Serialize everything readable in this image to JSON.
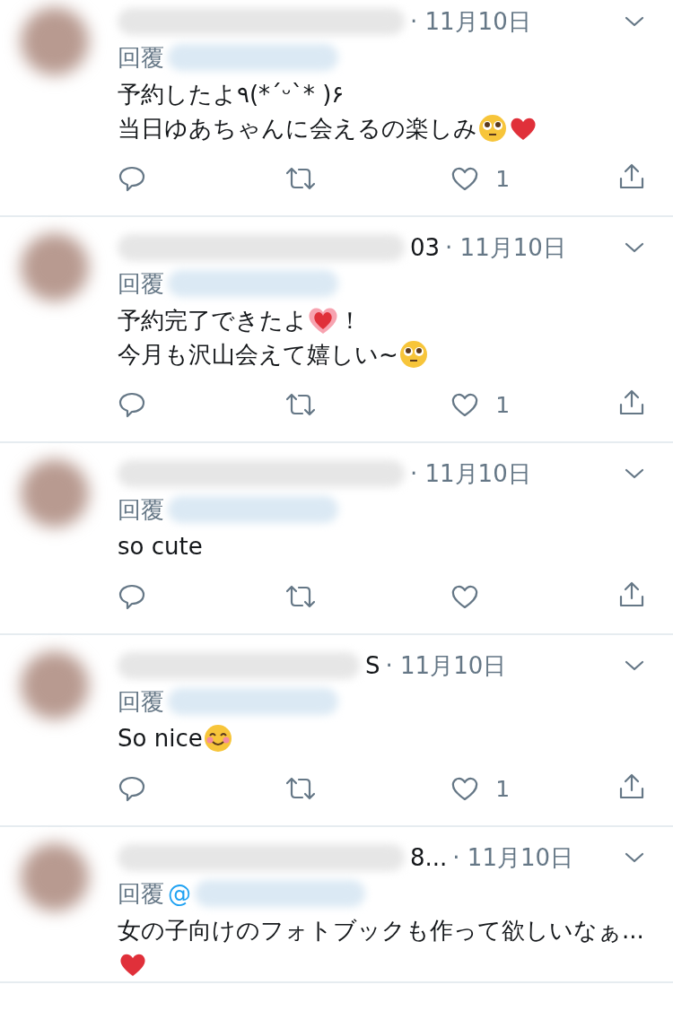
{
  "tweets": [
    {
      "date": "· 11月10日",
      "reply_label": "回覆",
      "body": [
        [
          {
            "kind": "text",
            "text": "予約したよ٩(*´ᵕ`* )۶"
          }
        ],
        [
          {
            "kind": "text",
            "text": "当日ゆあちゃんに会えるの楽しみ"
          },
          {
            "kind": "pleading"
          },
          {
            "kind": "heart"
          }
        ]
      ],
      "likes": "1"
    },
    {
      "name_tail": "03",
      "date": "· 11月10日",
      "reply_label": "回覆",
      "body": [
        [
          {
            "kind": "text",
            "text": "予約完了できたよ"
          },
          {
            "kind": "glowing-heart"
          },
          {
            "kind": "text",
            "text": "！"
          }
        ],
        [
          {
            "kind": "text",
            "text": "今月も沢山会えて嬉しい~"
          },
          {
            "kind": "pleading"
          }
        ]
      ],
      "likes": "1"
    },
    {
      "date": "· 11月10日",
      "reply_label": "回覆",
      "body": [
        [
          {
            "kind": "text",
            "text": "so cute"
          }
        ]
      ]
    },
    {
      "name_tail": "S",
      "date": "· 11月10日",
      "reply_label": "回覆",
      "body": [
        [
          {
            "kind": "text",
            "text": "So nice "
          },
          {
            "kind": "smiling"
          }
        ]
      ],
      "likes": "1"
    },
    {
      "name_tail": "8...",
      "date": "· 11月10日",
      "reply_label": "回覆",
      "reply_to": "@",
      "body": [
        [
          {
            "kind": "text",
            "text": "女の子向けのフォトブックも作って欲しいなぁ..."
          }
        ],
        [
          {
            "kind": "heart"
          }
        ]
      ],
      "cut_off": true
    }
  ]
}
